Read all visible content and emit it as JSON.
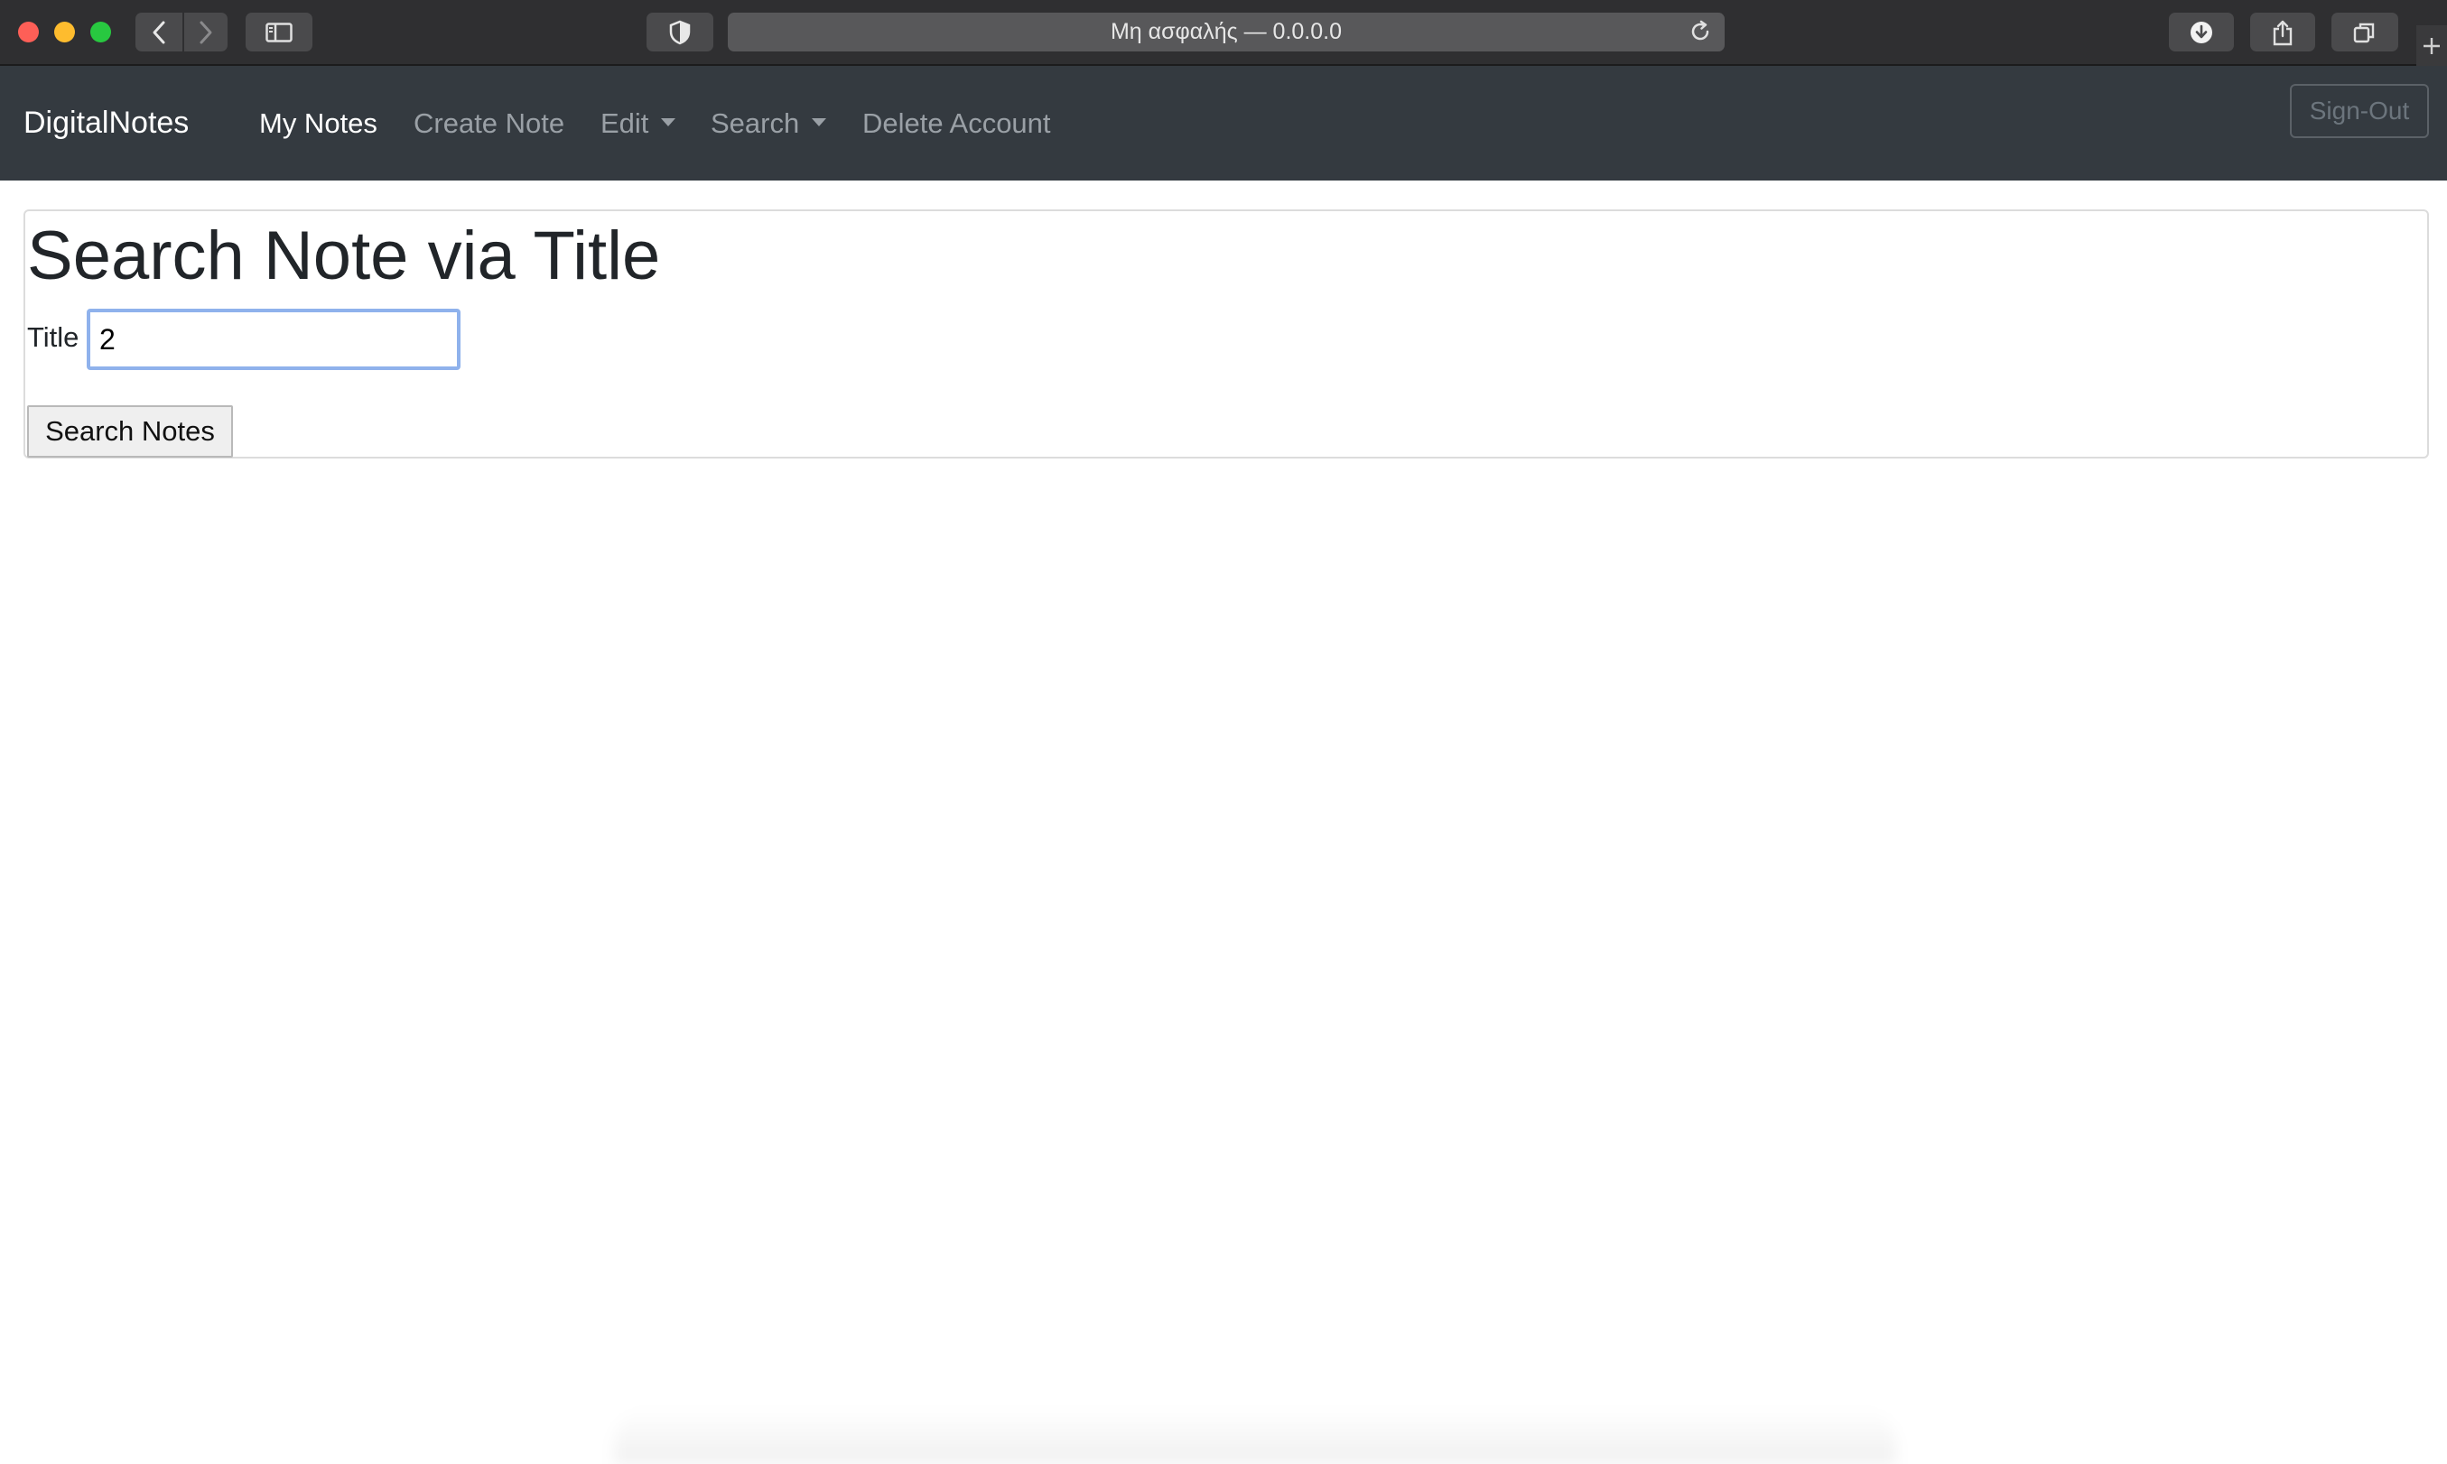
{
  "browser": {
    "address_text": "Μη ασφαλής — 0.0.0.0",
    "icons": [
      "back-icon",
      "forward-icon",
      "sidebar-icon",
      "shield-icon",
      "reload-icon",
      "download-icon",
      "share-icon",
      "tabs-icon",
      "new-tab-icon"
    ]
  },
  "navbar": {
    "brand": "DigitalNotes",
    "items": [
      {
        "label": "My Notes",
        "active": true
      },
      {
        "label": "Create Note"
      },
      {
        "label": "Edit",
        "dropdown": true
      },
      {
        "label": "Search",
        "dropdown": true
      },
      {
        "label": "Delete Account"
      }
    ],
    "signout_label": "Sign-Out",
    "background": "#343a40"
  },
  "main": {
    "title": "Search Note via Title",
    "field_label": "Title",
    "field_value": "2",
    "submit_label": "Search Notes"
  }
}
